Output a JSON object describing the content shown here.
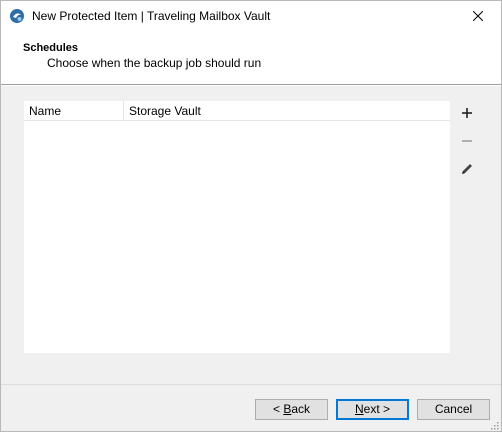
{
  "window": {
    "title": "New Protected Item | Traveling Mailbox Vault"
  },
  "header": {
    "title": "Schedules",
    "subtitle": "Choose when the backup job should run"
  },
  "grid": {
    "columns": [
      "Name",
      "Storage Vault"
    ],
    "rows": []
  },
  "tools": {
    "add_icon": "plus-icon",
    "remove_icon": "minus-icon",
    "edit_icon": "pencil-icon"
  },
  "footer": {
    "back_prefix": "< ",
    "back_mnemonic": "B",
    "back_rest": "ack",
    "next_mnemonic": "N",
    "next_rest": "ext >",
    "cancel_label": "Cancel"
  },
  "colors": {
    "accent": "#0078d7",
    "app_icon": "#2e6ea6"
  }
}
